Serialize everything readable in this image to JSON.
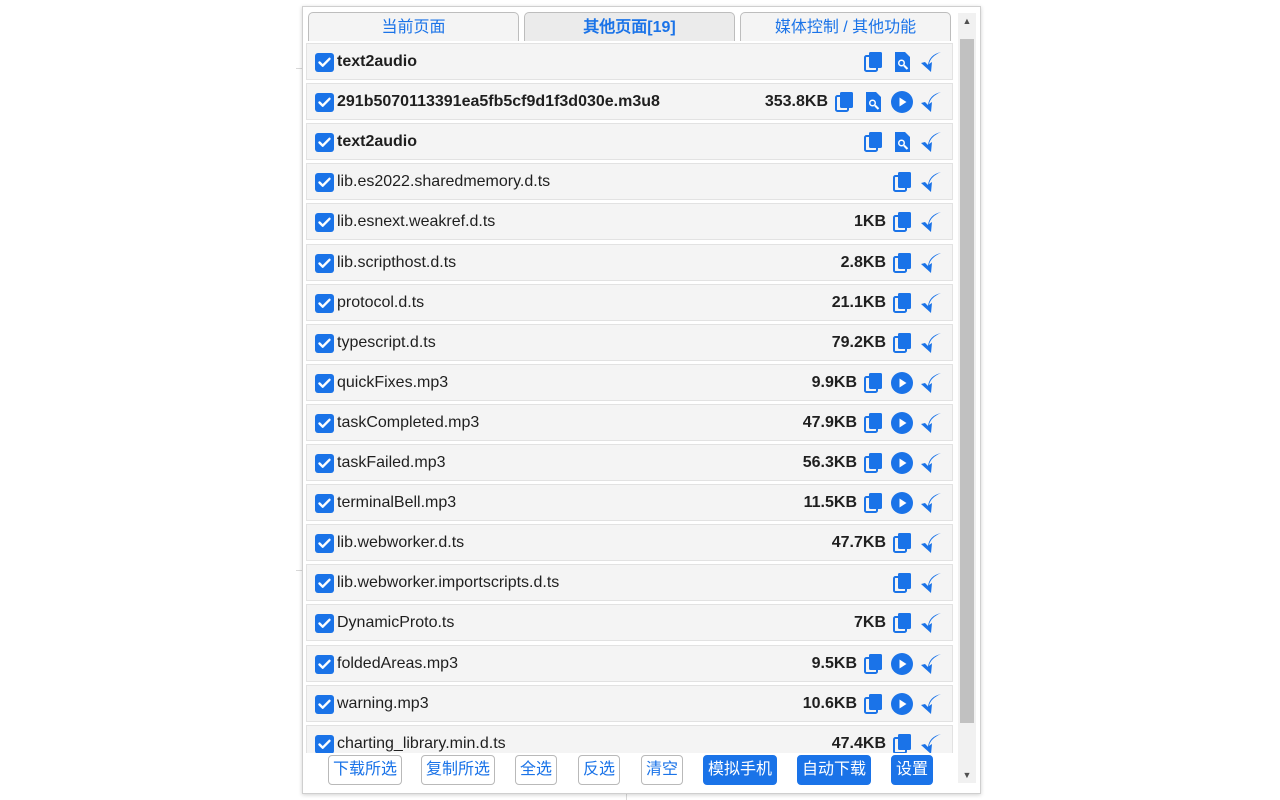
{
  "colors": {
    "accent": "#1a73e8",
    "row_bg": "#f4f4f4",
    "scroll_thumb": "#c1c1c1"
  },
  "tabs": [
    {
      "label": "当前页面",
      "active": false
    },
    {
      "label": "其他页面[19]",
      "active": true
    },
    {
      "label": "媒体控制 / 其他功能",
      "active": false
    }
  ],
  "files": [
    {
      "name": "text2audio",
      "size": "",
      "bold": true,
      "actions": [
        "copy-icon",
        "search-icon",
        "download-icon"
      ]
    },
    {
      "name": "291b5070113391ea5fb5cf9d1f3d030e.m3u8",
      "size": "353.8KB",
      "bold": true,
      "actions": [
        "copy-icon",
        "search-icon",
        "play-icon",
        "download-icon"
      ]
    },
    {
      "name": "text2audio",
      "size": "",
      "bold": true,
      "actions": [
        "copy-icon",
        "search-icon",
        "download-icon"
      ]
    },
    {
      "name": "lib.es2022.sharedmemory.d.ts",
      "size": "",
      "bold": false,
      "actions": [
        "copy-icon",
        "download-icon"
      ]
    },
    {
      "name": "lib.esnext.weakref.d.ts",
      "size": "1KB",
      "bold": false,
      "actions": [
        "copy-icon",
        "download-icon"
      ]
    },
    {
      "name": "lib.scripthost.d.ts",
      "size": "2.8KB",
      "bold": false,
      "actions": [
        "copy-icon",
        "download-icon"
      ]
    },
    {
      "name": "protocol.d.ts",
      "size": "21.1KB",
      "bold": false,
      "actions": [
        "copy-icon",
        "download-icon"
      ]
    },
    {
      "name": "typescript.d.ts",
      "size": "79.2KB",
      "bold": false,
      "actions": [
        "copy-icon",
        "download-icon"
      ]
    },
    {
      "name": "quickFixes.mp3",
      "size": "9.9KB",
      "bold": false,
      "actions": [
        "copy-icon",
        "play-icon",
        "download-icon"
      ]
    },
    {
      "name": "taskCompleted.mp3",
      "size": "47.9KB",
      "bold": false,
      "actions": [
        "copy-icon",
        "play-icon",
        "download-icon"
      ]
    },
    {
      "name": "taskFailed.mp3",
      "size": "56.3KB",
      "bold": false,
      "actions": [
        "copy-icon",
        "play-icon",
        "download-icon"
      ]
    },
    {
      "name": "terminalBell.mp3",
      "size": "11.5KB",
      "bold": false,
      "actions": [
        "copy-icon",
        "play-icon",
        "download-icon"
      ]
    },
    {
      "name": "lib.webworker.d.ts",
      "size": "47.7KB",
      "bold": false,
      "actions": [
        "copy-icon",
        "download-icon"
      ]
    },
    {
      "name": "lib.webworker.importscripts.d.ts",
      "size": "",
      "bold": false,
      "actions": [
        "copy-icon",
        "download-icon"
      ]
    },
    {
      "name": "DynamicProto.ts",
      "size": "7KB",
      "bold": false,
      "actions": [
        "copy-icon",
        "download-icon"
      ]
    },
    {
      "name": "foldedAreas.mp3",
      "size": "9.5KB",
      "bold": false,
      "actions": [
        "copy-icon",
        "play-icon",
        "download-icon"
      ]
    },
    {
      "name": "warning.mp3",
      "size": "10.6KB",
      "bold": false,
      "actions": [
        "copy-icon",
        "play-icon",
        "download-icon"
      ]
    },
    {
      "name": "charting_library.min.d.ts",
      "size": "47.4KB",
      "bold": false,
      "actions": [
        "copy-icon",
        "download-icon"
      ]
    }
  ],
  "footer": {
    "download_selected": "下载所选",
    "copy_selected": "复制所选",
    "select_all": "全选",
    "invert_selection": "反选",
    "clear": "清空",
    "emulate_mobile": "模拟手机",
    "auto_download": "自动下载",
    "settings": "设置"
  }
}
